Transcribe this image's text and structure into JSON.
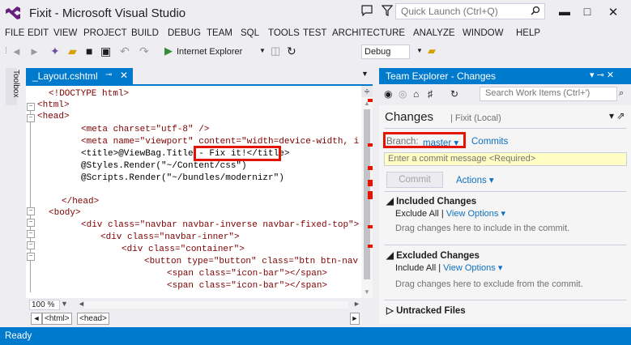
{
  "title": "Fixit - Microsoft Visual Studio",
  "quick_launch": {
    "placeholder": "Quick Launch (Ctrl+Q)"
  },
  "menu": [
    "FILE",
    "EDIT",
    "VIEW",
    "PROJECT",
    "BUILD",
    "DEBUG",
    "TEAM",
    "SQL",
    "TOOLS",
    "TEST",
    "ARCHITECTURE",
    "ANALYZE",
    "WINDOW",
    "HELP"
  ],
  "toolbar": {
    "browser": "Internet Explorer",
    "config": "Debug"
  },
  "toolbox": {
    "label": "Toolbox"
  },
  "editor": {
    "tab": "_Layout.cshtml",
    "zoom": "100 %",
    "breadcrumbs": [
      "<html>",
      "<head>"
    ],
    "code": [
      "<!DOCTYPE html>",
      "<html>",
      "<head>",
      "<meta charset=\"utf-8\" />",
      "<meta name=\"viewport\" content=\"width=device-width, i",
      "<title>@ViewBag.Title - Fix it!</title>",
      "@Styles.Render(\"~/Content/css\")",
      "@Scripts.Render(\"~/bundles/modernizr\")",
      "",
      "</head>",
      "<body>",
      "<div class=\"navbar navbar-inverse navbar-fixed-top\">",
      "<div class=\"navbar-inner\">",
      "<div class=\"container\">",
      "<button type=\"button\" class=\"btn btn-nav",
      "<span class=\"icon-bar\"></span>",
      "<span class=\"icon-bar\"></span>"
    ]
  },
  "team_explorer": {
    "title": "Team Explorer - Changes",
    "search_placeholder": "Search Work Items (Ctrl+')",
    "page_title": "Changes",
    "page_subtitle": "| Fixit (Local)",
    "branch_label": "Branch:",
    "branch": "master",
    "commits_link": "Commits",
    "commit_placeholder": "Enter a commit message <Required>",
    "commit_button": "Commit",
    "actions": "Actions",
    "included": {
      "title": "Included Changes",
      "exclude_all": "Exclude All",
      "view_options": "View Options",
      "hint": "Drag changes here to include in the commit."
    },
    "excluded": {
      "title": "Excluded Changes",
      "include_all": "Include All",
      "view_options": "View Options",
      "hint": "Drag changes here to exclude from the commit."
    },
    "untracked": {
      "title": "Untracked Files"
    }
  },
  "status": "Ready",
  "colors": {
    "accent": "#007acc",
    "highlight": "#e51400",
    "link": "#0e70c0"
  }
}
